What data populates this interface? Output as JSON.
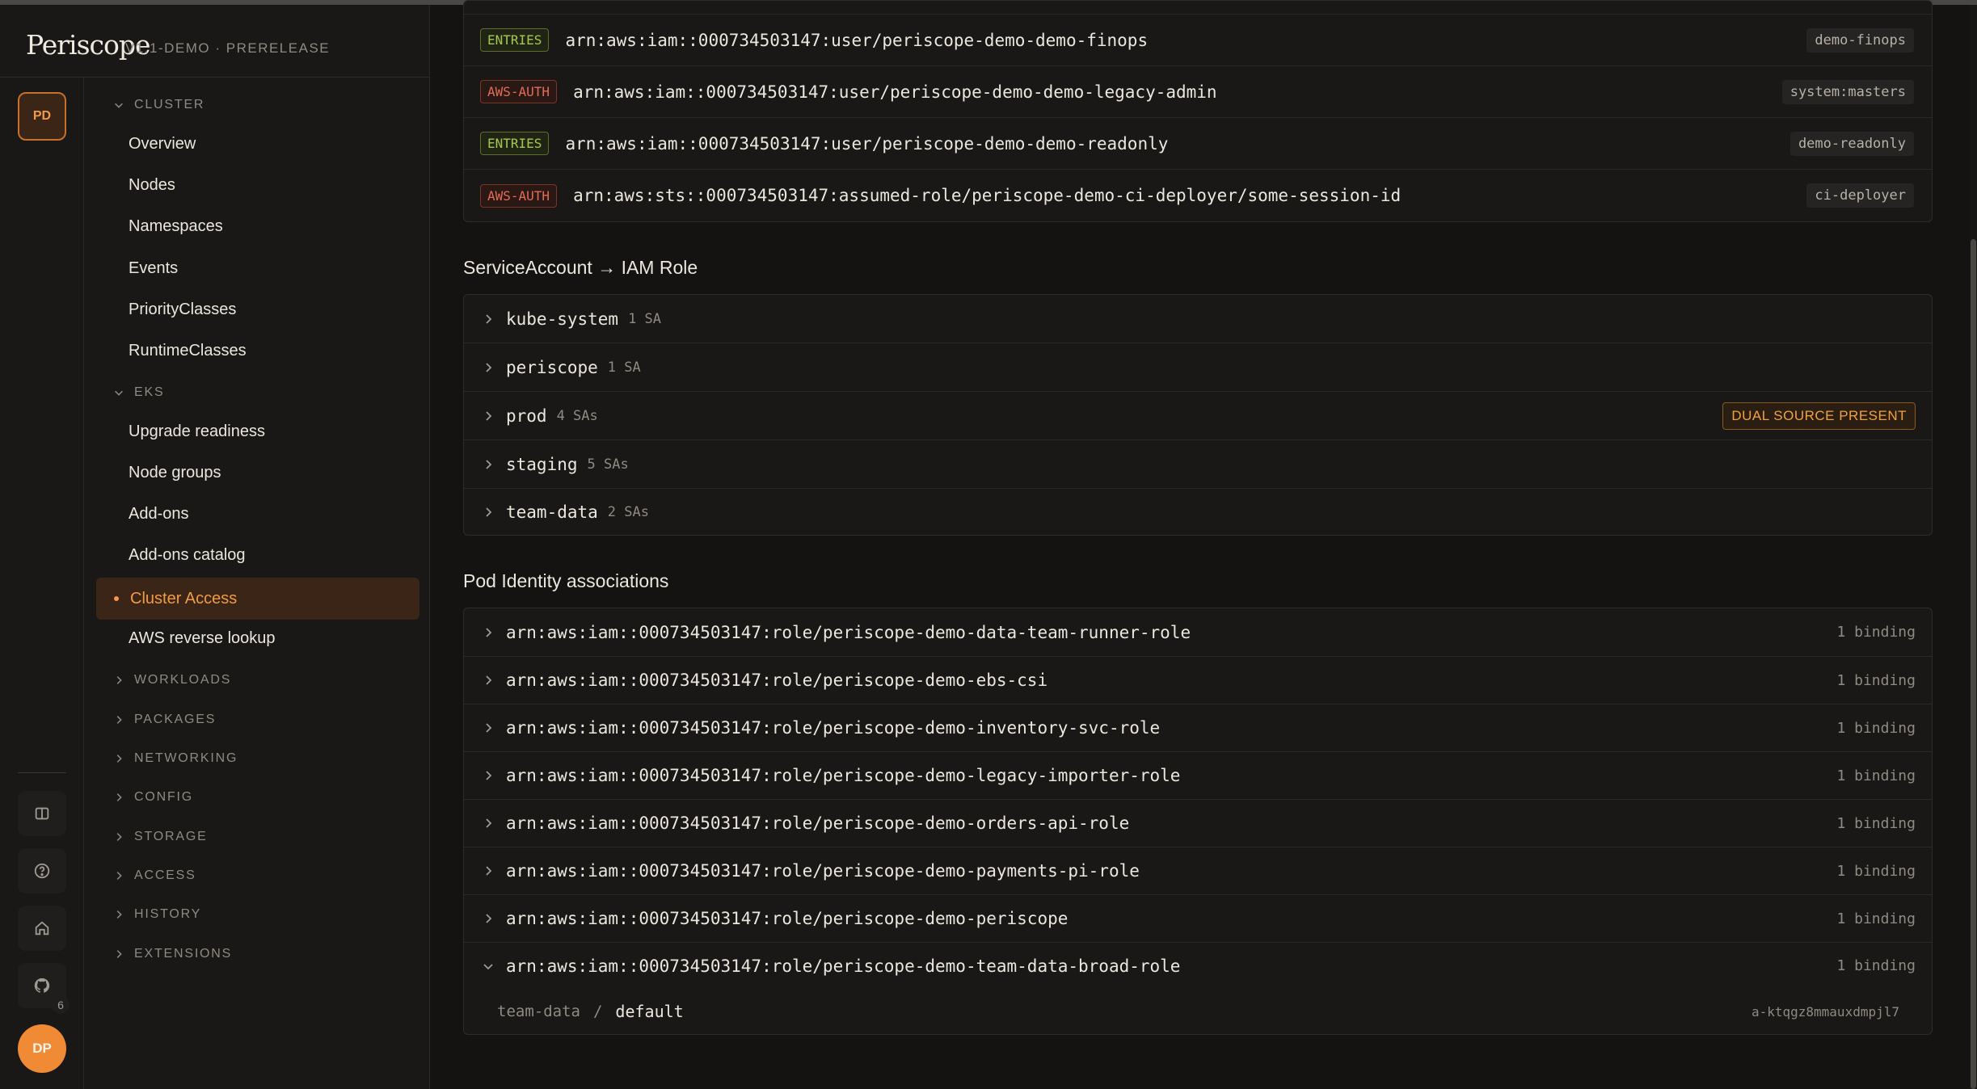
{
  "app": {
    "name": "Periscope",
    "version": "V1.1-DEMO · PRERELEASE"
  },
  "rail": {
    "cluster_badge": "PD",
    "github_count": "6",
    "avatar": "DP"
  },
  "sidebar": {
    "cluster": {
      "label": "CLUSTER",
      "items": [
        "Overview",
        "Nodes",
        "Namespaces",
        "Events",
        "PriorityClasses",
        "RuntimeClasses"
      ]
    },
    "eks": {
      "label": "EKS",
      "items": [
        "Upgrade readiness",
        "Node groups",
        "Add-ons",
        "Add-ons catalog",
        "Cluster Access",
        "AWS reverse lookup"
      ],
      "active": "Cluster Access"
    },
    "collapsed": [
      "WORKLOADS",
      "PACKAGES",
      "NETWORKING",
      "CONFIG",
      "STORAGE",
      "ACCESS",
      "HISTORY",
      "EXTENSIONS"
    ]
  },
  "mappings": [
    {
      "source": "ENTRIES",
      "arn": "arn:aws:iam::000734503147:user/periscope-demo-demo-finops",
      "group": "demo-finops"
    },
    {
      "source": "AWS-AUTH",
      "arn": "arn:aws:iam::000734503147:user/periscope-demo-demo-legacy-admin",
      "group": "system:masters"
    },
    {
      "source": "ENTRIES",
      "arn": "arn:aws:iam::000734503147:user/periscope-demo-demo-readonly",
      "group": "demo-readonly"
    },
    {
      "source": "AWS-AUTH",
      "arn": "arn:aws:sts::000734503147:assumed-role/periscope-demo-ci-deployer/some-session-id",
      "group": "ci-deployer"
    }
  ],
  "sa_section": {
    "title": "ServiceAccount → IAM Role",
    "namespaces": [
      {
        "name": "kube-system",
        "count": "1 SA"
      },
      {
        "name": "periscope",
        "count": "1 SA"
      },
      {
        "name": "prod",
        "count": "4 SAs",
        "badge": "DUAL SOURCE PRESENT"
      },
      {
        "name": "staging",
        "count": "5 SAs"
      },
      {
        "name": "team-data",
        "count": "2 SAs"
      }
    ]
  },
  "pod_identity": {
    "title": "Pod Identity associations",
    "roles": [
      {
        "arn": "arn:aws:iam::000734503147:role/periscope-demo-data-team-runner-role",
        "bindings": "1 binding"
      },
      {
        "arn": "arn:aws:iam::000734503147:role/periscope-demo-ebs-csi",
        "bindings": "1 binding"
      },
      {
        "arn": "arn:aws:iam::000734503147:role/periscope-demo-inventory-svc-role",
        "bindings": "1 binding"
      },
      {
        "arn": "arn:aws:iam::000734503147:role/periscope-demo-legacy-importer-role",
        "bindings": "1 binding"
      },
      {
        "arn": "arn:aws:iam::000734503147:role/periscope-demo-orders-api-role",
        "bindings": "1 binding"
      },
      {
        "arn": "arn:aws:iam::000734503147:role/periscope-demo-payments-pi-role",
        "bindings": "1 binding"
      },
      {
        "arn": "arn:aws:iam::000734503147:role/periscope-demo-periscope",
        "bindings": "1 binding"
      },
      {
        "arn": "arn:aws:iam::000734503147:role/periscope-demo-team-data-broad-role",
        "bindings": "1 binding",
        "expanded": true
      }
    ],
    "expanded_binding": {
      "namespace": "team-data",
      "separator": "/",
      "service_account": "default",
      "id": "a-ktqgz8mmauxdmpjl7"
    }
  }
}
